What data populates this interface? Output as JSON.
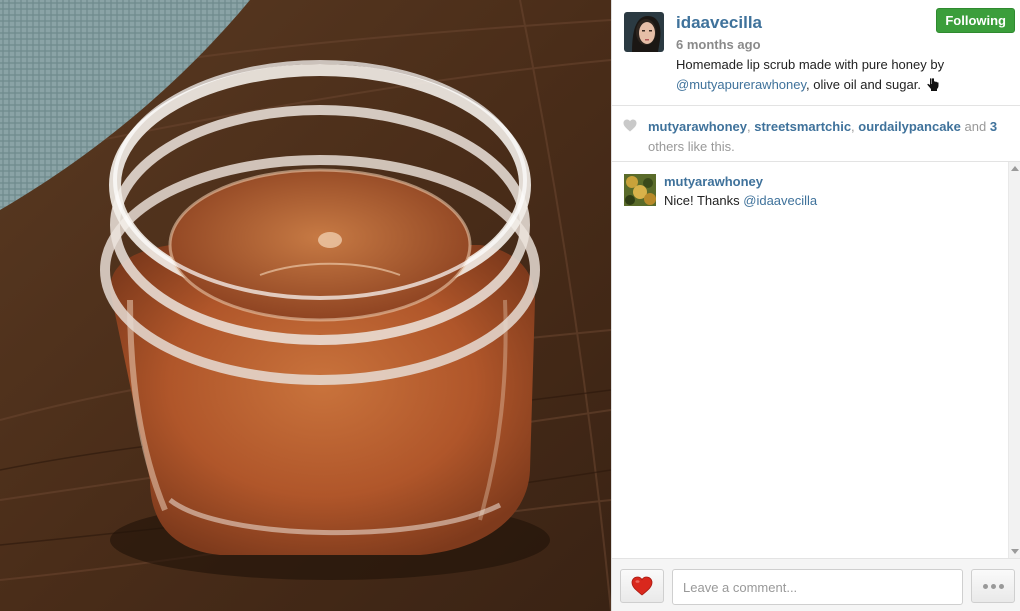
{
  "post": {
    "username": "idaavecilla",
    "time_ago": "6 months ago",
    "follow_label": "Following",
    "caption_prefix": "Homemade lip scrub made with pure honey by ",
    "caption_mention": "@mutyapurerawhoney",
    "caption_suffix": ", olive oil and sugar.",
    "caption_icon": "pointing-hand-icon"
  },
  "likes": {
    "user1": "mutyarawhoney",
    "sep1": ", ",
    "user2": "streetsmartchic",
    "sep2": ", ",
    "user3": "ourdailypancake",
    "and_text": " and ",
    "others_count": "3",
    "others_text": " others like this."
  },
  "comments": [
    {
      "username": "mutyarawhoney",
      "text": "Nice! Thanks ",
      "mention": "@idaavecilla"
    }
  ],
  "footer": {
    "comment_placeholder": "Leave a comment...",
    "like_icon": "heart-icon",
    "more_icon": "ellipsis-icon"
  },
  "colors": {
    "link": "#3f729b",
    "follow_button": "#3b9e3b",
    "heart": "#d9281d"
  }
}
